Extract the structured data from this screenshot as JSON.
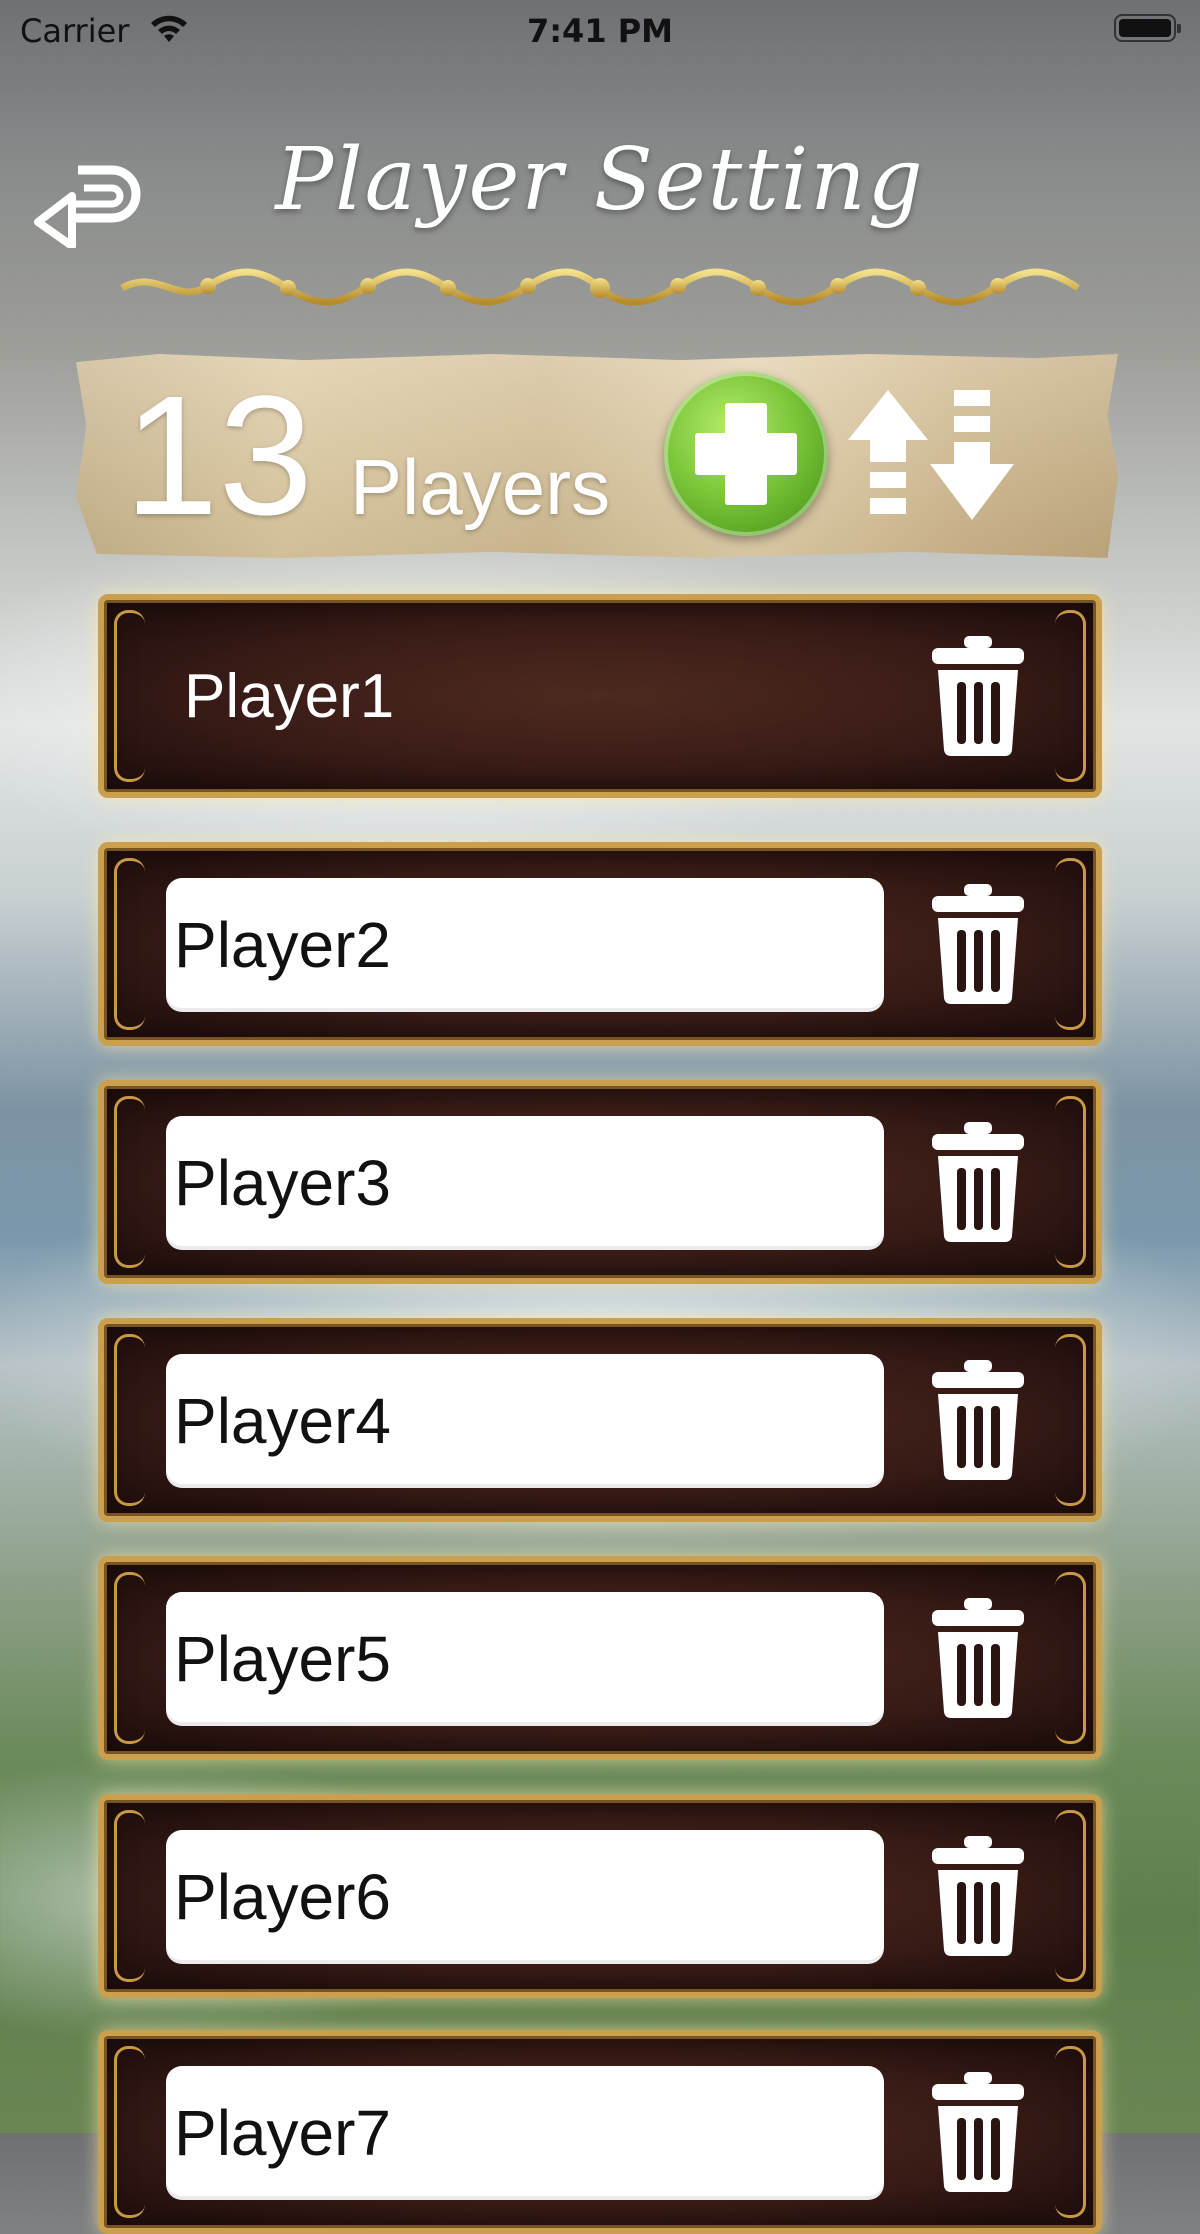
{
  "status_bar": {
    "carrier": "Carrier",
    "time": "7:41 PM"
  },
  "header": {
    "title": "Player Setting",
    "back_icon": "back-arrow-icon"
  },
  "summary": {
    "count": "13",
    "count_label": "Players",
    "add_icon": "add-icon",
    "sort_icon": "sort-icon"
  },
  "players": [
    {
      "name": "Player1",
      "editable": false
    },
    {
      "name": "Player2",
      "editable": true
    },
    {
      "name": "Player3",
      "editable": true
    },
    {
      "name": "Player4",
      "editable": true
    },
    {
      "name": "Player5",
      "editable": true
    },
    {
      "name": "Player6",
      "editable": true
    },
    {
      "name": "Player7",
      "editable": true
    }
  ],
  "colors": {
    "add_button": "#7cc63a",
    "row_frame": "#caa04e",
    "row_fill": "#3a1c17"
  }
}
